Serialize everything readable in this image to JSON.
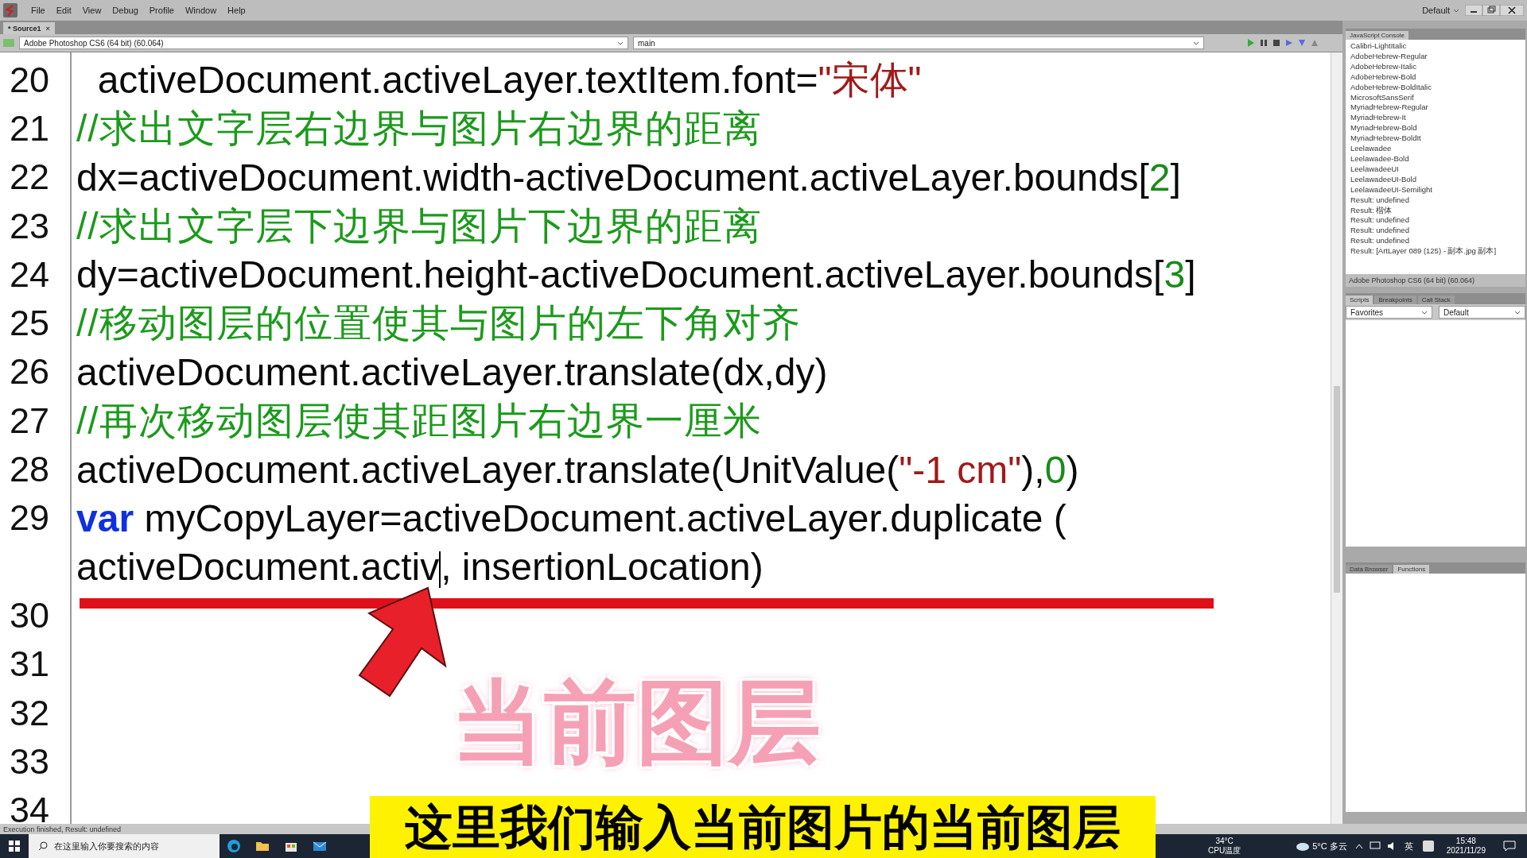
{
  "menu": [
    "File",
    "Edit",
    "View",
    "Debug",
    "Profile",
    "Window",
    "Help"
  ],
  "workspace": "Default",
  "document_tab": {
    "label": "* Source1",
    "close": "×"
  },
  "toolbar": {
    "target": "Adobe Photoshop CS6 (64 bit) (60.064)",
    "function": "main"
  },
  "code": [
    {
      "number": "20",
      "tokens": [
        {
          "kind": "plain",
          "text": "  activeDocument.activeLayer.textItem.font="
        },
        {
          "kind": "string",
          "text": "\"宋体\""
        }
      ]
    },
    {
      "number": "21",
      "tokens": [
        {
          "kind": "comment",
          "text": "//求出文字层右边界与图片右边界的距离"
        }
      ]
    },
    {
      "number": "22",
      "tokens": [
        {
          "kind": "plain",
          "text": "dx=activeDocument.width-activeDocument.activeLayer.bounds["
        },
        {
          "kind": "number",
          "text": "2"
        },
        {
          "kind": "plain",
          "text": "]"
        }
      ]
    },
    {
      "number": "23",
      "tokens": [
        {
          "kind": "comment",
          "text": "//求出文字层下边界与图片下边界的距离"
        }
      ]
    },
    {
      "number": "24",
      "tokens": [
        {
          "kind": "plain",
          "text": "dy=activeDocument.height-activeDocument.activeLayer.bounds["
        },
        {
          "kind": "number",
          "text": "3"
        },
        {
          "kind": "plain",
          "text": "]"
        }
      ]
    },
    {
      "number": "25",
      "tokens": [
        {
          "kind": "comment",
          "text": "//移动图层的位置使其与图片的左下角对齐"
        }
      ]
    },
    {
      "number": "26",
      "tokens": [
        {
          "kind": "plain",
          "text": "activeDocument.activeLayer.translate(dx,dy)"
        }
      ]
    },
    {
      "number": "27",
      "tokens": [
        {
          "kind": "comment",
          "text": "//再次移动图层使其距图片右边界一厘米"
        }
      ]
    },
    {
      "number": "28",
      "tokens": [
        {
          "kind": "plain",
          "text": "activeDocument.activeLayer.translate(UnitValue("
        },
        {
          "kind": "string",
          "text": "\"-1 cm\""
        },
        {
          "kind": "plain",
          "text": "),"
        },
        {
          "kind": "number",
          "text": "0"
        },
        {
          "kind": "plain",
          "text": ")"
        }
      ]
    },
    {
      "number": "29",
      "tokens": [
        {
          "kind": "keyword",
          "text": "var"
        },
        {
          "kind": "plain",
          "text": " myCopyLayer=activeDocument.activeLayer.duplicate ("
        }
      ]
    },
    {
      "tokens": [
        {
          "kind": "plain",
          "text": "activeDocument.activ"
        },
        {
          "kind": "caret"
        },
        {
          "kind": "plain",
          "text": ", insertionLocation)"
        }
      ]
    },
    {
      "number": "30"
    },
    {
      "number": "31"
    },
    {
      "number": "32"
    },
    {
      "number": "33"
    },
    {
      "number": "34"
    }
  ],
  "console": {
    "tab": "JavaScript Console",
    "lines": [
      "Calibri-LightItalic",
      "AdobeHebrew-Regular",
      "AdobeHebrew-Italic",
      "AdobeHebrew-Bold",
      "AdobeHebrew-BoldItalic",
      "MicrosoftSansSerif",
      "MyriadHebrew-Regular",
      "MyriadHebrew-It",
      "MyriadHebrew-Bold",
      "MyriadHebrew-BoldIt",
      "Leelawadee",
      "Leelawadee-Bold",
      "LeelawadeeUI",
      "LeelawadeeUI-Bold",
      "LeelawadeeUI-Semilight",
      "Result: undefined",
      "Result: 楷体",
      "Result: undefined",
      "Result: undefined",
      "Result: undefined",
      "Result: [ArtLayer 089 (125) - 副本.jpg 副本]"
    ],
    "target": "Adobe Photoshop CS6 (64 bit) (60.064)"
  },
  "scripts_panel": {
    "tabs": [
      {
        "label": "Scripts",
        "selected": true
      },
      {
        "label": "Breakpoints",
        "selected": false
      },
      {
        "label": "Call Stack",
        "selected": false
      }
    ],
    "selects": [
      "Favorites",
      "Default"
    ]
  },
  "data_panel": {
    "tabs": [
      {
        "label": "Data Browser",
        "selected": false
      },
      {
        "label": "Functions",
        "selected": true
      }
    ]
  },
  "status_bar": "Execution finished, Result: undefined",
  "taskbar": {
    "search_placeholder": "在这里输入你要搜索的内容",
    "cpu_temp": "34°C",
    "cpu_label": "CPU温度",
    "weather": "5°C 多云",
    "ime": "英",
    "time": "15:48",
    "date": "2021/11/29"
  },
  "overlay": {
    "callout": "当前图层",
    "caption": "这里我们输入当前图片的当前图层"
  }
}
